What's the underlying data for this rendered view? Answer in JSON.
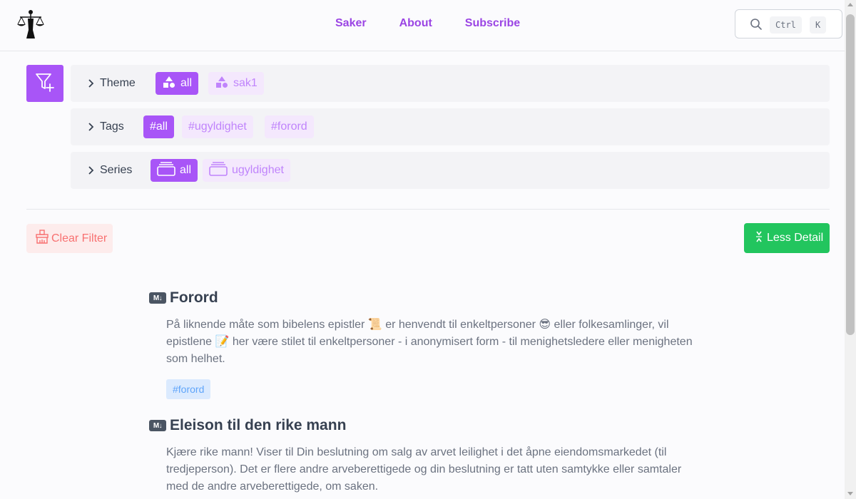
{
  "header": {
    "logo_icon": "scales-of-justice-logo-icon",
    "nav": [
      "Saker",
      "About",
      "Subscribe"
    ],
    "search": {
      "icon": "search-icon",
      "kbd_ctrl": "Ctrl",
      "kbd_k": "K"
    }
  },
  "filters": {
    "toggle_icon": "filter-plus-icon",
    "rows": [
      {
        "label": "Theme",
        "chips": [
          {
            "label": "all",
            "active": true
          },
          {
            "label": "sak1",
            "active": false
          }
        ]
      },
      {
        "label": "Tags",
        "chips": [
          {
            "label": "#all",
            "active": true
          },
          {
            "label": "#ugyldighet",
            "active": false
          },
          {
            "label": "#forord",
            "active": false
          }
        ]
      },
      {
        "label": "Series",
        "chips": [
          {
            "label": "all",
            "active": true
          },
          {
            "label": "ugyldighet",
            "active": false
          }
        ]
      }
    ]
  },
  "actions": {
    "clear_filter": "Clear Filter",
    "less_detail": "Less Detail"
  },
  "articles": [
    {
      "badge": "M↓",
      "title": "Forord",
      "body": "På liknende måte som bibelens epistler 📜 er henvendt til enkeltpersoner 😎 eller folkesamlinger, vil epistlene 📝 her være stilet til enkeltpersoner - i anonymisert form - til menighetsledere eller menigheten som helhet.",
      "tag": "#forord"
    },
    {
      "badge": "M↓",
      "title": "Eleison til den rike mann",
      "body": "Kjære rike mann! Viser til Din beslutning om salg av arvet leilighet i det åpne eiendomsmarkedet (til tredjeperson). Det er flere andre arveberettigede og din beslutning er tatt uten samtykke eller samtaler med de andre arveberettigede, om saken."
    }
  ],
  "colors": {
    "accent": "#a855f7",
    "accent_soft": "#f4e8fd",
    "success": "#22c55e",
    "danger": "#f87171",
    "tag_bg": "#dbeafe"
  }
}
